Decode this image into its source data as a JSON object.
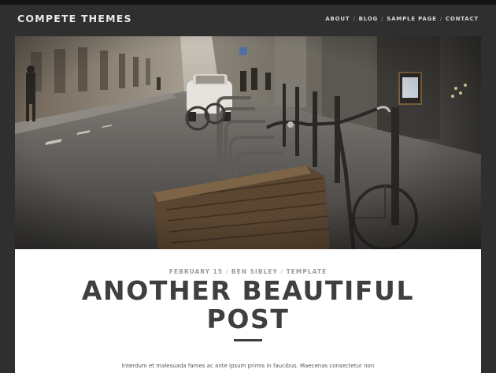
{
  "site": {
    "logo": "COMPETE THEMES"
  },
  "nav": {
    "items": [
      {
        "label": "ABOUT"
      },
      {
        "label": "BLOG"
      },
      {
        "label": "SAMPLE PAGE"
      },
      {
        "label": "CONTACT"
      }
    ],
    "separator": "/"
  },
  "post": {
    "date": "FEBRUARY 15",
    "author": "BEN SIBLEY",
    "category": "TEMPLATE",
    "meta_separator": "/",
    "title_line1": "ANOTHER BEAUTIFUL",
    "title_line2": "POST",
    "excerpt": "Interdum et malesuada fames ac ante ipsum primis in faucibus. Maecenas consectetur non"
  },
  "colors": {
    "background": "#2f2f2f",
    "card": "#ffffff",
    "title": "#3f3f3f"
  }
}
